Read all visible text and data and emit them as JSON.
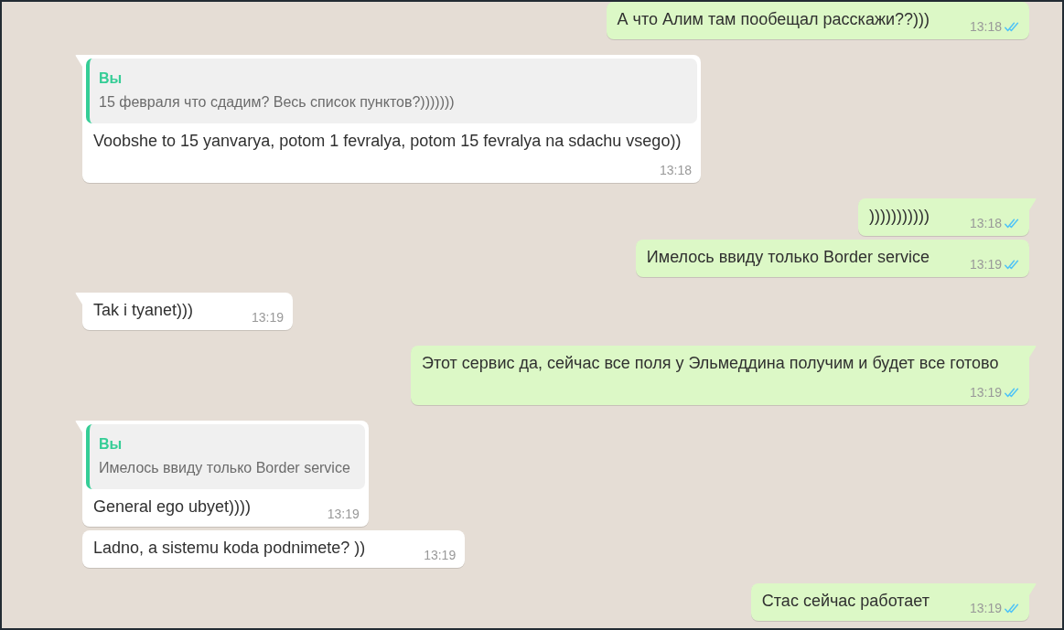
{
  "chat": {
    "messages": [
      {
        "kind": "outgoing",
        "tail": false,
        "text": "А что Алим там пообещал расскажи??)))",
        "time": "13:18",
        "read": true
      },
      {
        "kind": "incoming",
        "tail": true,
        "quote": {
          "author": "Вы",
          "text": "15 февраля что сдадим? Весь список пунктов?)))))))"
        },
        "text": "Voobshe to 15 yanvarya, potom 1 fevralya, potom 15 fevralya na sdachu vsego))",
        "time": "13:18"
      },
      {
        "kind": "outgoing",
        "tail": true,
        "text": ")))))))))))",
        "time": "13:18",
        "read": true
      },
      {
        "kind": "outgoing",
        "tail": false,
        "text": "Имелось ввиду только Border service",
        "time": "13:19",
        "read": true
      },
      {
        "kind": "incoming",
        "tail": true,
        "text": "Tak i tyanet)))",
        "time": "13:19"
      },
      {
        "kind": "outgoing",
        "tail": true,
        "text": "Этот сервис да, сейчас все поля у Эльмеддина получим и будет все готово",
        "time": "13:19",
        "read": true
      },
      {
        "kind": "incoming",
        "tail": true,
        "quote": {
          "author": "Вы",
          "text": "Имелось ввиду только Border service"
        },
        "text": "General ego ubyet))))",
        "time": "13:19"
      },
      {
        "kind": "incoming",
        "tail": false,
        "text": "Ladno, a sistemu koda podnimete? ))",
        "time": "13:19"
      },
      {
        "kind": "outgoing",
        "tail": true,
        "text": "Стас сейчас работает",
        "time": "13:19",
        "read": true
      }
    ]
  }
}
